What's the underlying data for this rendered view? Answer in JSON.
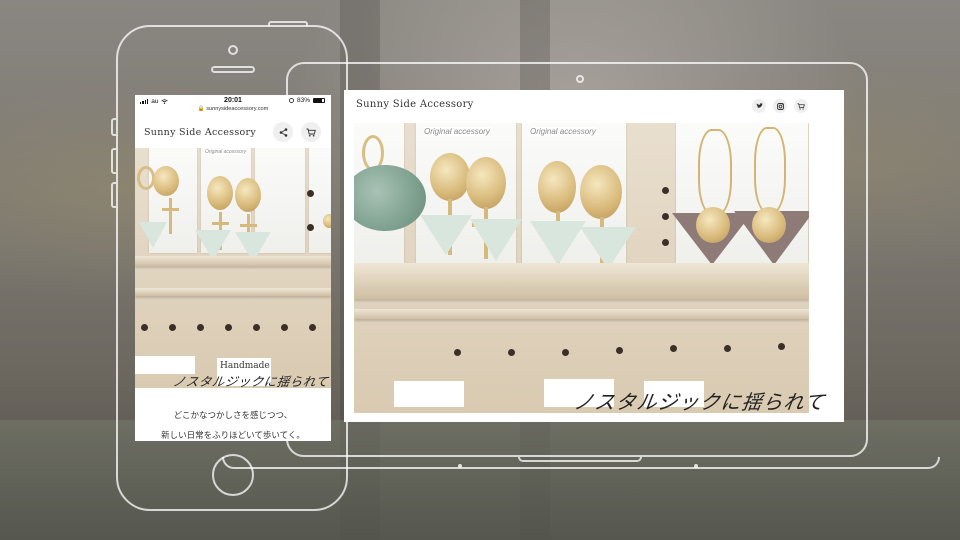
{
  "site": {
    "title": "Sunny Side Accessory"
  },
  "phone": {
    "status": {
      "carrier": "au",
      "time": "20:01",
      "battery": "83%",
      "battery_level": 0.83
    },
    "url": "sunnysideaccessory.com",
    "catchphrase": "ノスタルジックに揺られて",
    "body_lines": [
      "どこかなつかしさを感じつつ、",
      "新しい日常をふりほどいて歩いてく。"
    ],
    "icons": [
      "share-icon",
      "cart-icon"
    ]
  },
  "laptop": {
    "catchphrase": "ノスタルジックに揺られて",
    "icons": [
      "twitter-icon",
      "instagram-icon",
      "cart-icon"
    ]
  },
  "photo": {
    "card_text": "Original accessory",
    "sign_text": "Handmade"
  }
}
